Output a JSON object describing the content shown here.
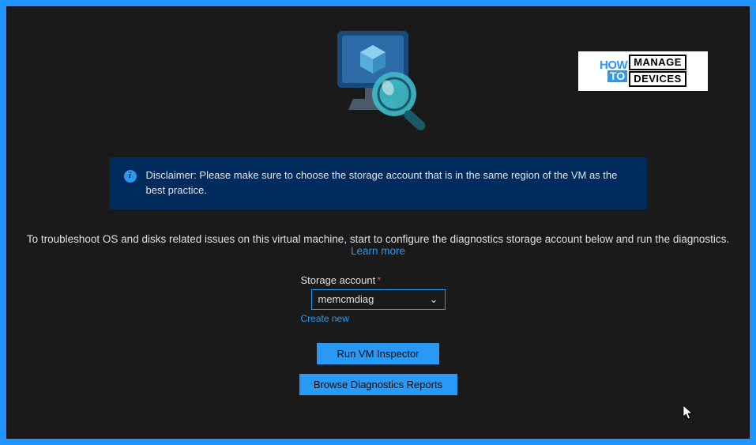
{
  "disclaimer": {
    "text": "Disclaimer: Please make sure to choose the storage account that is in the same region of the VM as the best practice."
  },
  "description": {
    "text": "To troubleshoot OS and disks related issues on this virtual machine, start to configure the diagnostics storage account below and run the diagnostics.",
    "learn_more": "Learn more"
  },
  "form": {
    "storage_label": "Storage account",
    "storage_value": "memcmdiag",
    "create_new": "Create new",
    "run_btn": "Run VM Inspector",
    "browse_btn": "Browse Diagnostics Reports"
  },
  "watermark": {
    "how": "HOW",
    "to": "TO",
    "manage": "MANAGE",
    "devices": "DEVICES"
  }
}
